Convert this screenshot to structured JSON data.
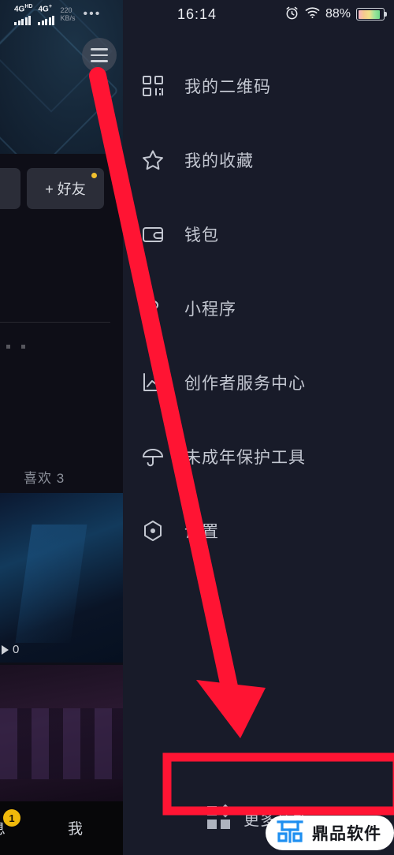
{
  "status_bar": {
    "network_1": "4G",
    "network_1_sup": "HD",
    "network_2": "4G",
    "network_2_sup": "+",
    "speed_value": "220",
    "speed_unit": "KB/s",
    "overflow": "•••",
    "time": "16:14",
    "battery_percent": "88%",
    "alarm_icon": "alarm-clock-icon",
    "wifi_icon": "wifi-icon",
    "battery_icon": "battery-icon"
  },
  "left_panel": {
    "hamburger_icon": "hamburger-menu-icon",
    "buttons": [
      {
        "label": "",
        "name": "profile-action-button"
      },
      {
        "label": "+ 好友",
        "name": "add-friend-button",
        "has_dot": true
      }
    ],
    "likes_label": "喜欢 3",
    "play_count": "0",
    "bottom_nav": [
      {
        "label": "息",
        "name": "nav-messages",
        "badge": "1"
      },
      {
        "label": "我",
        "name": "nav-profile",
        "badge": ""
      }
    ]
  },
  "drawer": {
    "items": [
      {
        "label": "我的二维码",
        "icon": "qr-code-icon",
        "name": "menu-item-my-qr-code"
      },
      {
        "label": "我的收藏",
        "icon": "star-icon",
        "name": "menu-item-my-favorites"
      },
      {
        "label": "钱包",
        "icon": "wallet-icon",
        "name": "menu-item-wallet"
      },
      {
        "label": "小程序",
        "icon": "mini-program-icon",
        "name": "menu-item-mini-program"
      },
      {
        "label": "创作者服务中心",
        "icon": "chart-icon",
        "name": "menu-item-creator-service-center"
      },
      {
        "label": "未成年保护工具",
        "icon": "umbrella-icon",
        "name": "menu-item-minor-protection-tools"
      },
      {
        "label": "设置",
        "icon": "settings-gear-icon",
        "name": "menu-item-settings"
      }
    ],
    "more_features": {
      "label": "更多功能",
      "icon": "grid-apps-icon"
    }
  },
  "annotation": {
    "color": "#ff1433",
    "arrow_name": "instruction-arrow",
    "highlight_name": "highlight-box"
  },
  "watermark": {
    "text": "鼎品软件",
    "logo_icon": "dingpin-logo-icon",
    "logo_color": "#1f8ff0"
  }
}
